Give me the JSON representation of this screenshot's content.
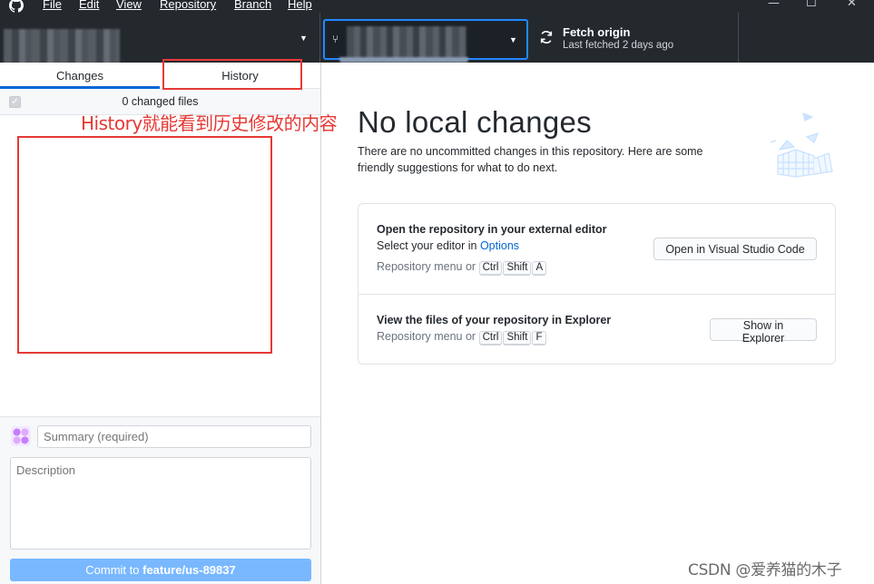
{
  "menubar": {
    "items": [
      "File",
      "Edit",
      "View",
      "Repository",
      "Branch",
      "Help"
    ],
    "window_controls": {
      "minimize": "—",
      "maximize": "☐",
      "close": "✕"
    }
  },
  "toolbar": {
    "repo_caret": "▼",
    "branch_caret": "▼",
    "fetch_title": "Fetch origin",
    "fetch_subtitle": "Last fetched 2 days ago"
  },
  "sidebar": {
    "tabs": [
      "Changes",
      "History"
    ],
    "changed_files": "0 changed files",
    "summary_placeholder": "Summary (required)",
    "description_placeholder": "Description",
    "commit_prefix": "Commit to ",
    "commit_branch": "feature/us-89837"
  },
  "annotation": {
    "text": "History就能看到历史修改的内容",
    "color": "#e53935"
  },
  "main": {
    "title": "No local changes",
    "description": "There are no uncommitted changes in this repository. Here are some friendly suggestions for what to do next.",
    "suggestions": [
      {
        "title": "Open the repository in your external editor",
        "line_prefix": "Select your editor in ",
        "line_link": "Options",
        "hint": "Repository menu or",
        "keys": [
          "Ctrl",
          "Shift",
          "A"
        ],
        "button": "Open in Visual Studio Code"
      },
      {
        "title": "View the files of your repository in Explorer",
        "hint": "Repository menu or",
        "keys": [
          "Ctrl",
          "Shift",
          "F"
        ],
        "button": "Show in Explorer"
      }
    ]
  },
  "watermark": "CSDN @爱养猫的木子",
  "colors": {
    "toolbar_bg": "#24292e",
    "accent": "#0366d6",
    "commit_button": "#79b8ff",
    "annotation": "#e53935"
  }
}
